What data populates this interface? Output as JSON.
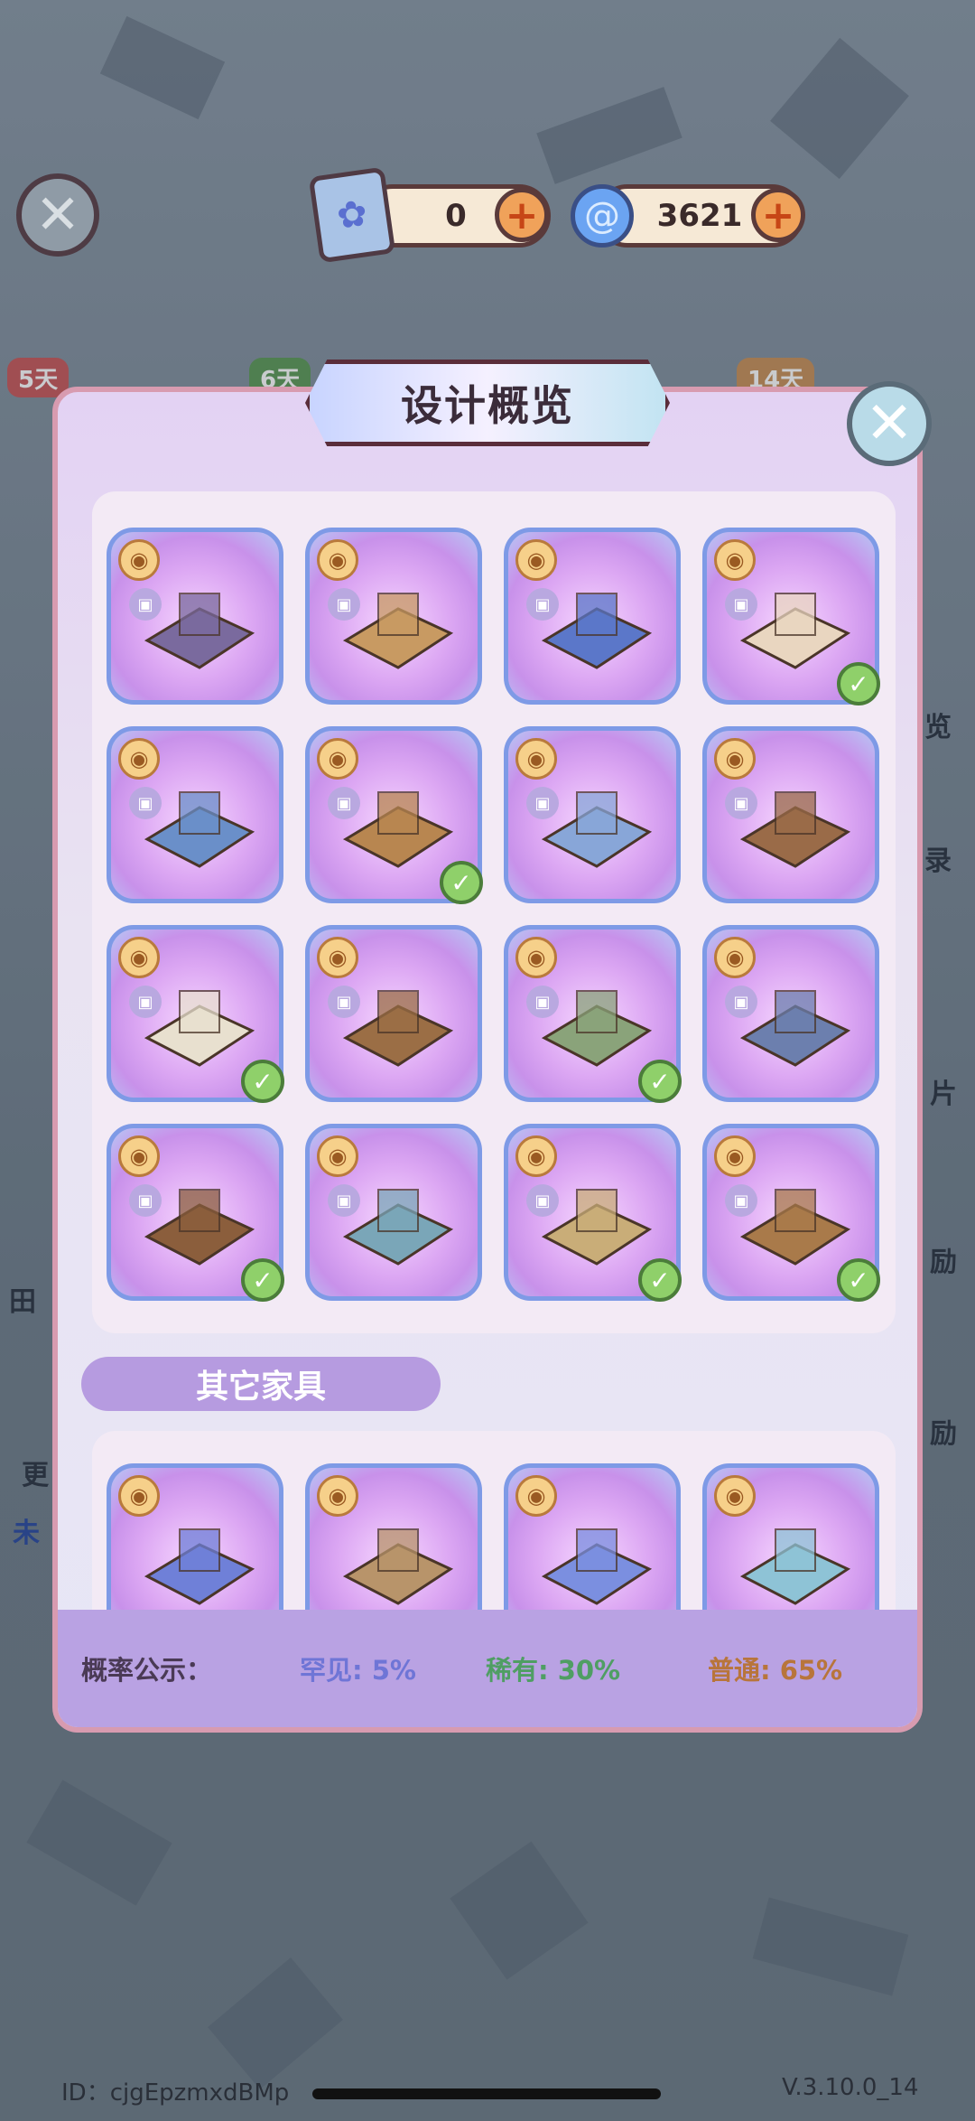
{
  "top_bar": {
    "ticket_count": "0",
    "gem_count": "3621"
  },
  "background": {
    "day_tags": [
      "5天",
      "6天",
      "14天"
    ],
    "side_texts": [
      "览",
      "录",
      "片",
      "励",
      "励",
      "田",
      "更",
      "未"
    ]
  },
  "modal": {
    "title": "设计概览",
    "section_title": "其它家具",
    "probability_label": "概率公示：",
    "rarities": [
      {
        "label": "罕见: 5%",
        "color": "#6f75d6"
      },
      {
        "label": "稀有: 30%",
        "color": "#4f9e63"
      },
      {
        "label": "普通: 65%",
        "color": "#b8753b"
      }
    ]
  },
  "design_items": [
    {
      "name": "hotpot-table",
      "owned": false
    },
    {
      "name": "wood-floor-plank",
      "owned": false
    },
    {
      "name": "flower-planter",
      "owned": false
    },
    {
      "name": "curtain-arch",
      "owned": true
    },
    {
      "name": "cushion-sofa",
      "owned": false
    },
    {
      "name": "wood-beam",
      "owned": true
    },
    {
      "name": "armchair-blue",
      "owned": false
    },
    {
      "name": "armchair-wood",
      "owned": false
    },
    {
      "name": "round-table-cloth",
      "owned": true
    },
    {
      "name": "garden-fence",
      "owned": false
    },
    {
      "name": "flower-patch-floor",
      "owned": true
    },
    {
      "name": "window-awning",
      "owned": false
    },
    {
      "name": "floral-screen",
      "owned": true
    },
    {
      "name": "glass-door",
      "owned": false
    },
    {
      "name": "mirror-panel",
      "owned": true
    },
    {
      "name": "wood-door",
      "owned": true
    }
  ],
  "other_items": [
    {
      "name": "petal-rug"
    },
    {
      "name": "flower-fence"
    },
    {
      "name": "hydrangea-bush"
    },
    {
      "name": "tea-table"
    }
  ],
  "footer": {
    "user_id": "ID：cjgEpzmxdBMp",
    "version": "V.3.10.0_14"
  },
  "colors": {
    "card_border": "#7e9ae6",
    "owned_check": "#8fd06a",
    "modal_border": "#d89bb0"
  }
}
